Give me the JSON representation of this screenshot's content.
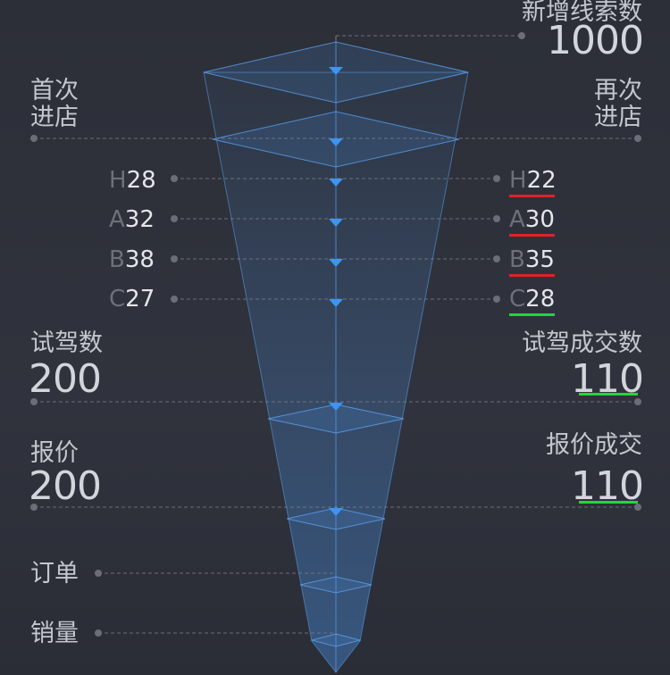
{
  "header": {
    "label": "新增线索数",
    "value": "1000"
  },
  "first_visit": {
    "label": "首次\n进店"
  },
  "return_visit": {
    "label": "再次\n进店"
  },
  "grades_first": [
    {
      "grade": "H",
      "value": "28"
    },
    {
      "grade": "A",
      "value": "32"
    },
    {
      "grade": "B",
      "value": "38"
    },
    {
      "grade": "C",
      "value": "27"
    }
  ],
  "grades_return": [
    {
      "grade": "H",
      "value": "22",
      "status_color": "#e0222a"
    },
    {
      "grade": "A",
      "value": "30",
      "status_color": "#e0222a"
    },
    {
      "grade": "B",
      "value": "35",
      "status_color": "#e0222a"
    },
    {
      "grade": "C",
      "value": "28",
      "status_color": "#22d63c"
    }
  ],
  "test_drive": {
    "label": "试驾数",
    "value": "200"
  },
  "test_drive_deal": {
    "label": "试驾成交数",
    "value": "110",
    "status_color": "#22d63c"
  },
  "quote": {
    "label": "报价",
    "value": "200"
  },
  "quote_deal": {
    "label": "报价成交",
    "value": "110",
    "status_color": "#22d63c"
  },
  "order": {
    "label": "订单"
  },
  "sales": {
    "label": "销量"
  },
  "colors": {
    "funnel_fill": "#4a90e2",
    "funnel_stroke": "#5aa0ef",
    "arrow": "#3d95f0",
    "guide": "#7a7e88",
    "dot": "#6a6e78"
  },
  "chart_data": {
    "type": "funnel",
    "stages": [
      {
        "name": "新增线索数",
        "value": 1000
      },
      {
        "name": "首次进店 / 再次进店",
        "grades_first": {
          "H": 28,
          "A": 32,
          "B": 38,
          "C": 27
        },
        "grades_return": {
          "H": 22,
          "A": 30,
          "B": 35,
          "C": 28
        }
      },
      {
        "name": "试驾数",
        "value": 200,
        "deal_name": "试驾成交数",
        "deal_value": 110
      },
      {
        "name": "报价",
        "value": 200,
        "deal_name": "报价成交",
        "deal_value": 110
      },
      {
        "name": "订单"
      },
      {
        "name": "销量"
      }
    ]
  }
}
